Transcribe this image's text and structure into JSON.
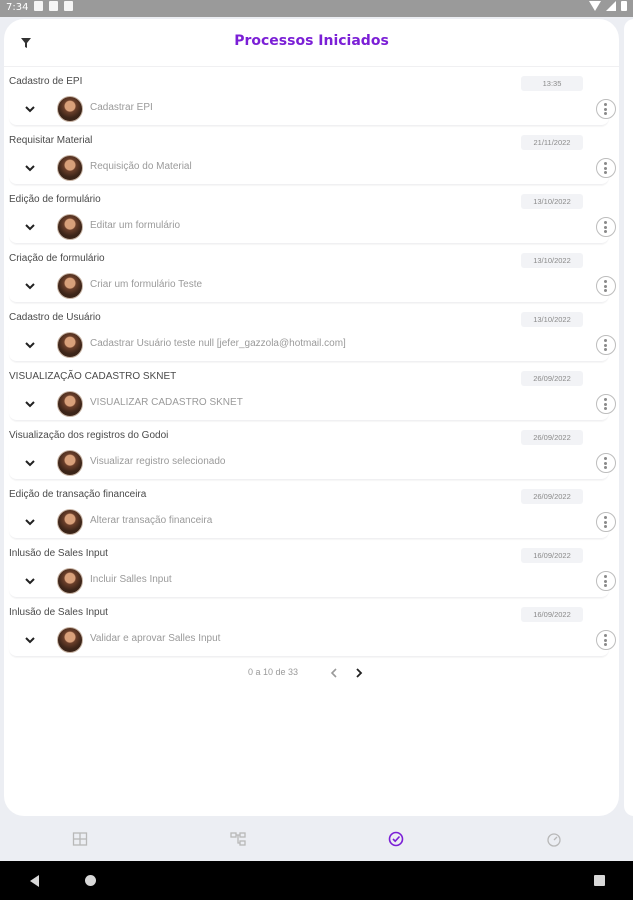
{
  "status_bar": {
    "time": "7:34"
  },
  "header": {
    "title": "Processos Iniciados"
  },
  "processes": [
    {
      "name": "Cadastro de EPI",
      "date": "13:35",
      "description": "Cadastrar EPI"
    },
    {
      "name": "Requisitar Material",
      "date": "21/11/2022",
      "description": "Requisição do Material"
    },
    {
      "name": "Edição de formulário",
      "date": "13/10/2022",
      "description": "Editar um formulário"
    },
    {
      "name": "Criação de formulário",
      "date": "13/10/2022",
      "description": "Criar um formulário Teste"
    },
    {
      "name": "Cadastro de Usuário",
      "date": "13/10/2022",
      "description": "Cadastrar Usuário teste null [jefer_gazzola@hotmail.com]"
    },
    {
      "name": "VISUALIZAÇÃO CADASTRO SKNET",
      "date": "26/09/2022",
      "description": "VISUALIZAR CADASTRO SKNET"
    },
    {
      "name": "Visualização dos registros do Godoi",
      "date": "26/09/2022",
      "description": "Visualizar registro selecionado"
    },
    {
      "name": "Edição de transação financeira",
      "date": "26/09/2022",
      "description": "Alterar transação financeira"
    },
    {
      "name": "Inlusão de Sales Input",
      "date": "16/09/2022",
      "description": "Incluir Salles Input"
    },
    {
      "name": "Inlusão de Sales Input",
      "date": "16/09/2022",
      "description": "Validar e aprovar Salles Input"
    }
  ],
  "pagination": {
    "info": "0 a 10 de 33"
  },
  "bottom_nav": {
    "items": [
      {
        "icon": "grid-icon",
        "active": false
      },
      {
        "icon": "workflow-icon",
        "active": false
      },
      {
        "icon": "check-circle-icon",
        "active": true
      },
      {
        "icon": "speedometer-icon",
        "active": false
      }
    ]
  },
  "colors": {
    "accent": "#7b1fd6",
    "text": "#4a4a4a",
    "muted": "#9a9a9a"
  }
}
